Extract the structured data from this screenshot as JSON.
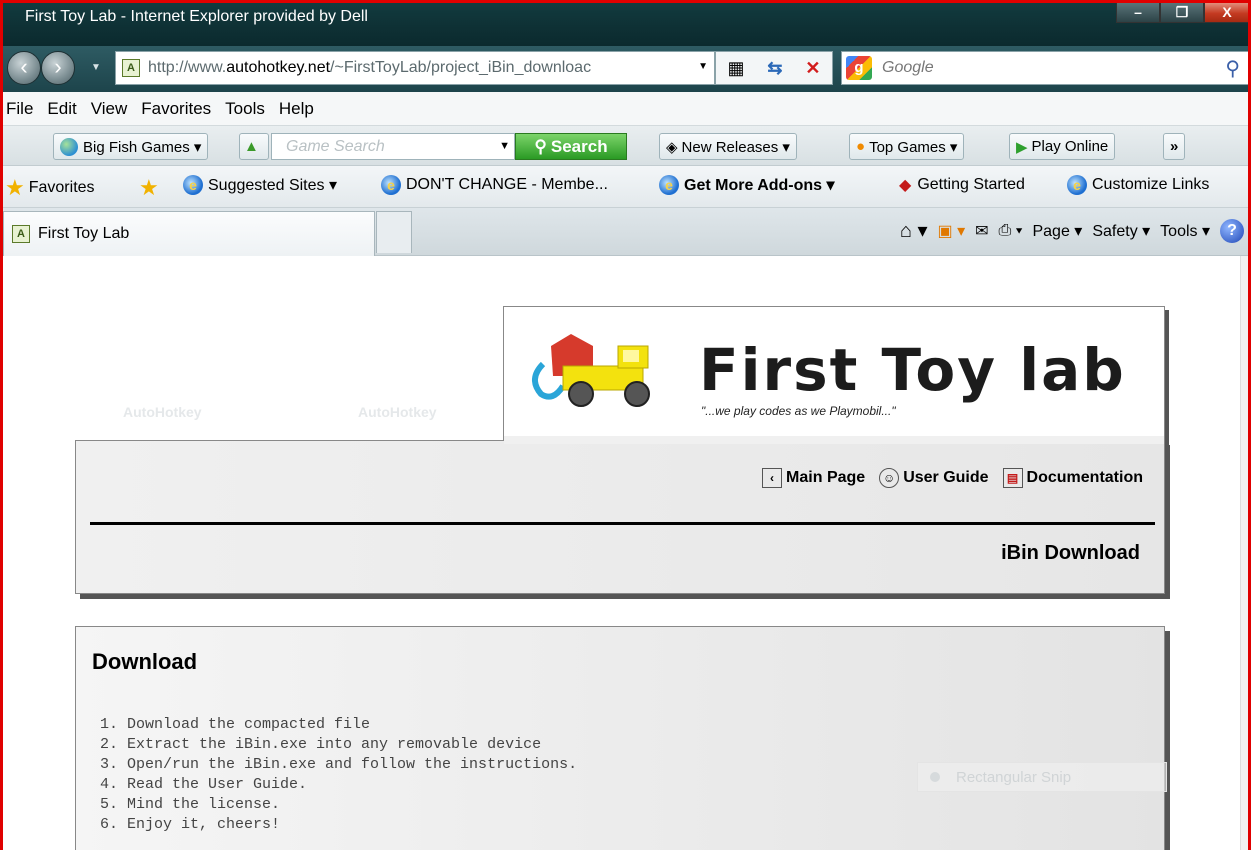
{
  "window": {
    "title": "First Toy Lab - Internet Explorer provided by Dell",
    "controls": [
      "–",
      "❐",
      "X"
    ]
  },
  "address": {
    "url_prefix": "http://www.",
    "url_host": "autohotkey.net",
    "url_rest": "/~FirstToyLab/project_iBin_downloac",
    "search_placeholder": "Google"
  },
  "menu": [
    "File",
    "Edit",
    "View",
    "Favorites",
    "Tools",
    "Help"
  ],
  "toolbar": {
    "bigfish": "Big Fish Games ▾",
    "game_search_placeholder": "Game Search",
    "search_button": "Search",
    "new_releases": "New Releases ▾",
    "top_games": "Top Games ▾",
    "play_online": "Play Online",
    "more": "»"
  },
  "favorites": {
    "favorites_label": "Favorites",
    "items": [
      "Suggested Sites ▾",
      "DON'T CHANGE - Membe...",
      "Get More Add-ons ▾",
      "Getting Started",
      "Customize Links"
    ]
  },
  "tab": {
    "label": "First Toy Lab",
    "commands": [
      "Page ▾",
      "Safety ▾",
      "Tools ▾"
    ]
  },
  "page": {
    "logo_title": "First Toy lab",
    "logo_tagline": "\"...we play codes as we Playmobil...\"",
    "nav": [
      "Main Page",
      "User Guide",
      "Documentation"
    ],
    "section_title": "iBin Download",
    "download_heading": "Download",
    "steps": [
      "1. Download the compacted file",
      "2. Extract the iBin.exe into any removable device",
      "3. Open/run the iBin.exe and follow the instructions.",
      "4. Read the User Guide.",
      "5. Mind the license.",
      "6. Enjoy it, cheers!"
    ],
    "watermark": "AutoHotkey"
  },
  "overlay": {
    "snip_label": "Rectangular Snip"
  },
  "colors": {
    "frame_border": "#e00000",
    "title_bar": "#0e3034",
    "search_green": "#2a9a24"
  }
}
